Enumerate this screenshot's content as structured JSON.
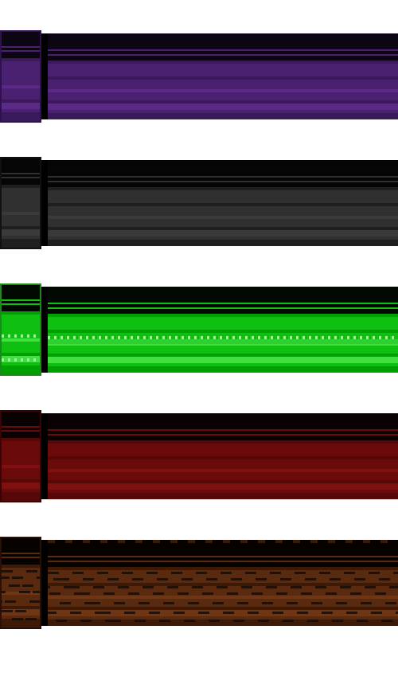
{
  "bars": [
    {
      "name": "purple",
      "color": "#4a2070",
      "border": "#2f1050",
      "variant": "plain",
      "shades": [
        "#0c0612",
        "#2a1240",
        "#3a1a5a",
        "#4a2070",
        "#5a2a86"
      ]
    },
    {
      "name": "gray",
      "color": "#262626",
      "border": "#111111",
      "variant": "plain",
      "shades": [
        "#050505",
        "#141414",
        "#1f1f1f",
        "#303030",
        "#3a3a3a"
      ]
    },
    {
      "name": "green",
      "color": "#00b000",
      "border": "#1a8a1a",
      "variant": "dotted",
      "shades": [
        "#020802",
        "#0a6a0a",
        "#00a000",
        "#10c010",
        "#40e040"
      ]
    },
    {
      "name": "red",
      "color": "#6a0a0a",
      "border": "#3a0404",
      "variant": "plain",
      "shades": [
        "#0a0202",
        "#3a0404",
        "#560808",
        "#6a0a0a",
        "#7e1010"
      ]
    },
    {
      "name": "wood",
      "color": "#5a2a0e",
      "border": "#2a1004",
      "variant": "grain",
      "shades": [
        "#050200",
        "#2a1004",
        "#3e1a06",
        "#5a2a0e",
        "#6e3614"
      ]
    }
  ]
}
